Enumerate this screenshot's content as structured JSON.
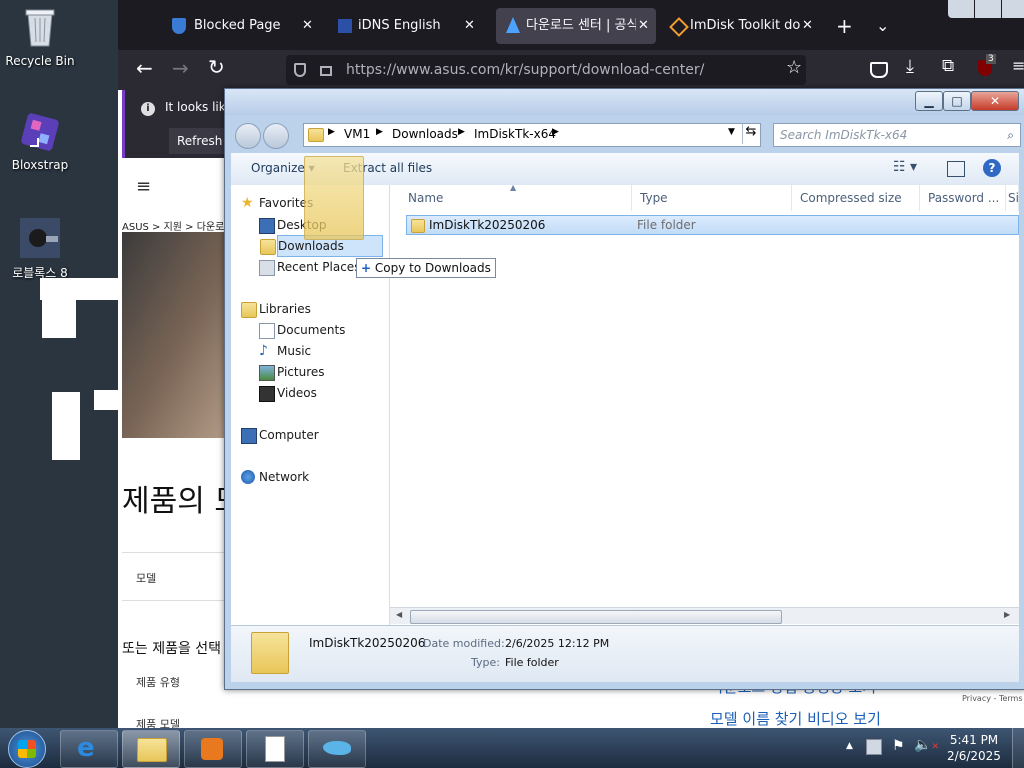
{
  "desktop": {
    "icons": [
      {
        "label": "Recycle Bin"
      },
      {
        "label": "Bloxstrap"
      },
      {
        "label": "로블록스 8"
      }
    ]
  },
  "browser": {
    "tabs": [
      {
        "label": "Blocked Page",
        "close": "✕"
      },
      {
        "label": "iDNS English",
        "close": "✕"
      },
      {
        "label": "다운로드 센터 | 공식",
        "close": "✕"
      },
      {
        "label": "ImDisk Toolkit downl",
        "close": "✕"
      }
    ],
    "new_tab": "+",
    "tab_list": "⌄",
    "url": "https://www.asus.com/kr/support/download-center/",
    "info_text": "It looks like",
    "refresh_label": "Refresh F",
    "ublock_badge": "3",
    "page": {
      "breadcrumb": "ASUS > 지원 > 다운로드",
      "heading": "제품의 모",
      "model_label": "모델",
      "or_select": "또는 제품을 선택",
      "product_type": "제품 유형",
      "product_model": "제품 모델",
      "bottom_line1": "다운로드 방법 동영상 보기",
      "bottom_line2": "모델 이름 찾기 비디오 보기",
      "privacy": "Privacy - Terms"
    }
  },
  "explorer": {
    "address": {
      "segments": [
        "VM1",
        "Downloads",
        "ImDiskTk-x64"
      ]
    },
    "search_placeholder": "Search ImDiskTk-x64",
    "toolbar": {
      "organize": "Organize",
      "extract_all": "Extract all files"
    },
    "nav": {
      "favorites": "Favorites",
      "desktop": "Desktop",
      "downloads": "Downloads",
      "recent_places": "Recent Places",
      "libraries": "Libraries",
      "documents": "Documents",
      "music": "Music",
      "pictures": "Pictures",
      "videos": "Videos",
      "computer": "Computer",
      "network": "Network"
    },
    "drag_tooltip": "Copy to Downloads",
    "columns": [
      "Name",
      "Type",
      "Compressed size",
      "Password ...",
      "Si"
    ],
    "rows": [
      {
        "name": "ImDiskTk20250206",
        "type": "File folder"
      }
    ],
    "details": {
      "name": "ImDiskTk20250206",
      "date_label": "Date modified:",
      "date_value": "2/6/2025 12:12 PM",
      "type_label": "Type:",
      "type_value": "File folder"
    }
  },
  "taskbar": {
    "time": "5:41 PM",
    "date": "2/6/2025"
  }
}
